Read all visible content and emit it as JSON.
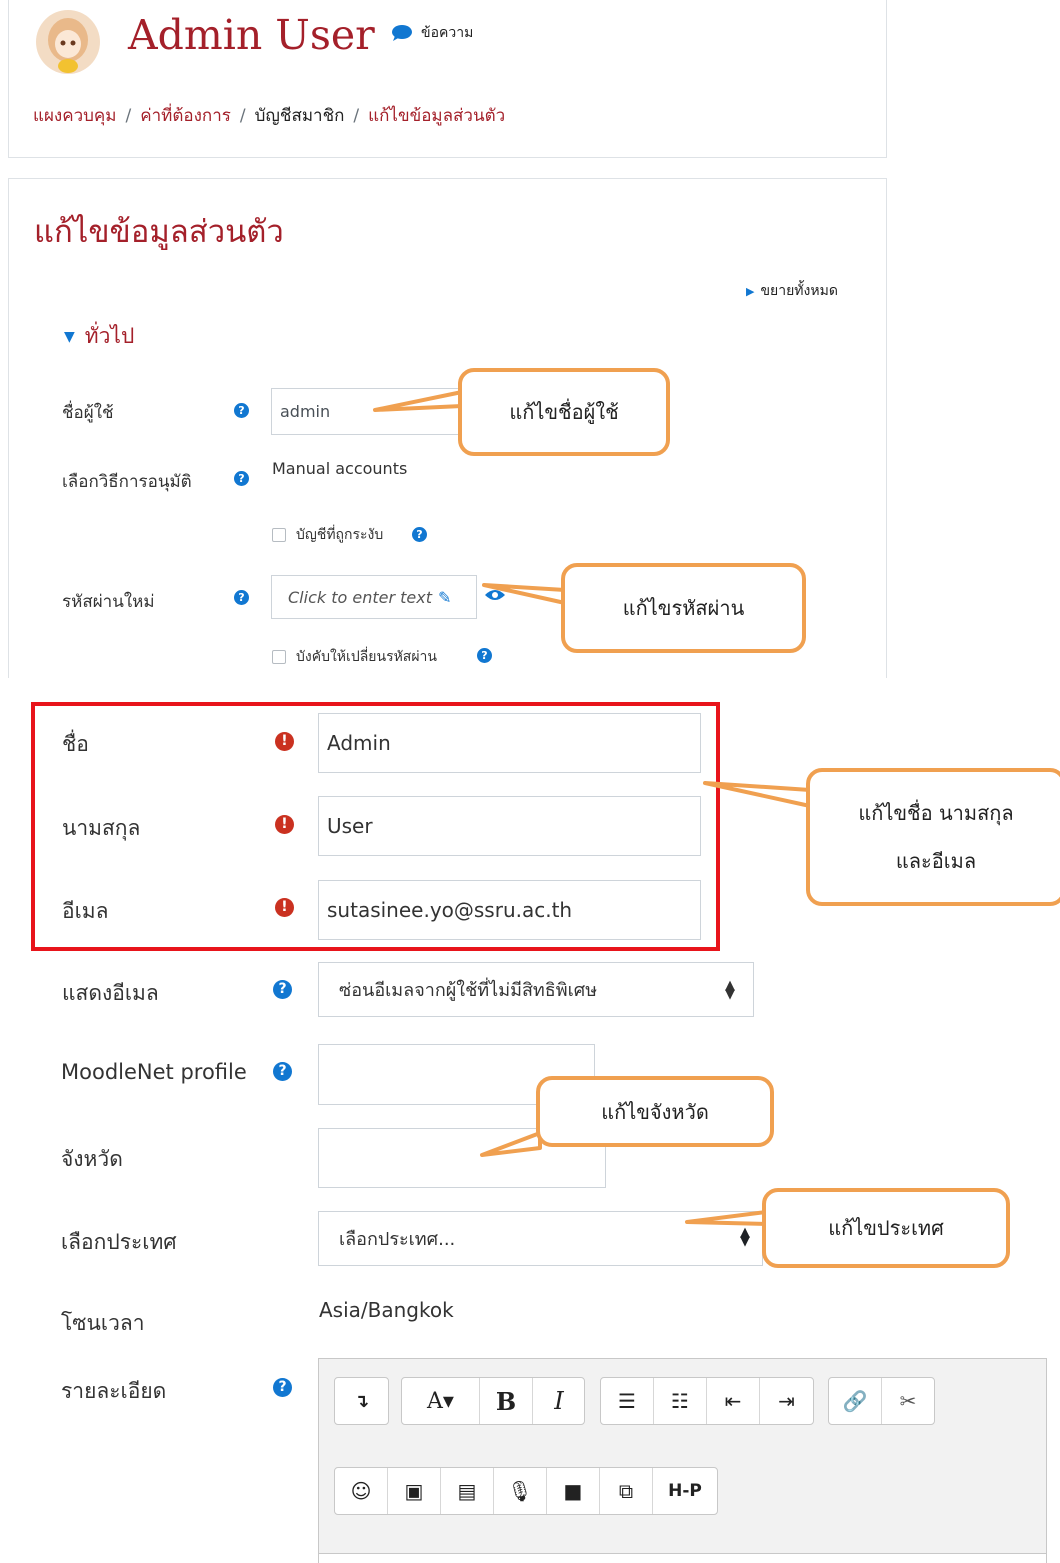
{
  "header": {
    "user_name": "Admin User",
    "message_label": "ข้อความ",
    "breadcrumb": [
      "แผงควบคุม",
      "ค่าที่ต้องการ",
      "บัญชีสมาชิก",
      "แก้ไขข้อมูลส่วนตัว"
    ]
  },
  "form": {
    "title": "แก้ไขข้อมูลส่วนตัว",
    "expand_all": "ขยายทั้งหมด",
    "section_general": "ทั่วไป",
    "username_label": "ชื่อผู้ใช้",
    "username_value": "admin",
    "auth_label": "เลือกวิธีการอนุมัติ",
    "auth_value": "Manual accounts",
    "suspended_label": "บัญชีที่ถูกระงับ",
    "newpassword_label": "รหัสผ่านใหม่",
    "password_placeholder": "Click to enter text",
    "force_change_label": "บังคับให้เปลี่ยนรหัสผ่าน",
    "firstname_label": "ชื่อ",
    "firstname_value": "Admin",
    "lastname_label": "นามสกุล",
    "lastname_value": "User",
    "email_label": "อีเมล",
    "email_value": "sutasinee.yo@ssru.ac.th",
    "showemail_label": "แสดงอีเมล",
    "showemail_value": "ซ่อนอีเมลจากผู้ใช้ที่ไม่มีสิทธิพิเศษ",
    "moodlenet_label": "MoodleNet profile",
    "city_label": "จังหวัด",
    "country_label": "เลือกประเทศ",
    "country_value": "เลือกประเทศ...",
    "timezone_label": "โซนเวลา",
    "timezone_value": "Asia/Bangkok",
    "description_label": "รายละเอียด"
  },
  "callouts": {
    "username": "แก้ไขชื่อผู้ใช้",
    "password": "แก้ไขรหัสผ่าน",
    "name_line1": "แก้ไขชื่อ นามสกุล",
    "name_line2": "และอีเมล",
    "city": "แก้ไขจังหวัด",
    "country": "แก้ไขประเทศ"
  },
  "colors": {
    "accent": "#a4202a",
    "help": "#1177d1",
    "required": "#ca3120",
    "callout_border": "#f0a050",
    "highlight": "#e8141b"
  }
}
